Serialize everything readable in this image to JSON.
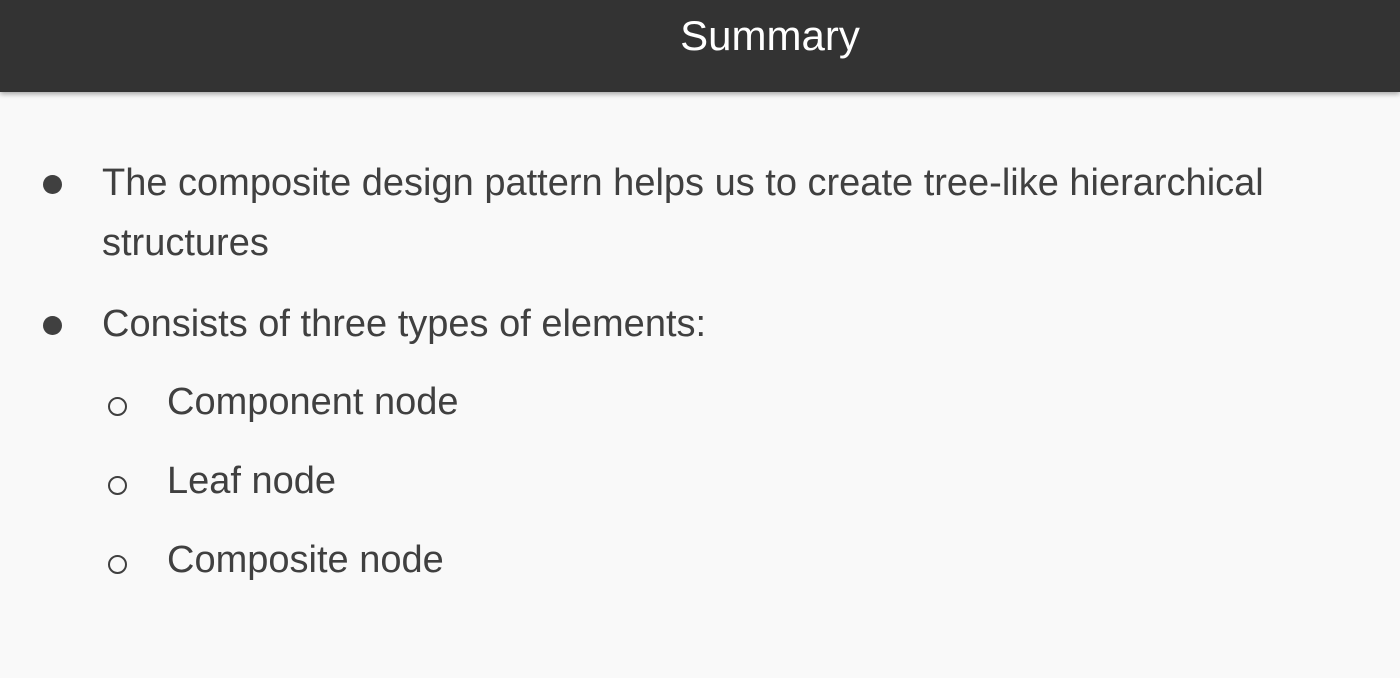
{
  "slide": {
    "title": "Summary",
    "bullets": [
      {
        "text": "The composite design pattern helps us to create tree-like hierarchical structures"
      },
      {
        "text": "Consists of three types of elements:",
        "sub_items": [
          {
            "text": "Component node"
          },
          {
            "text": "Leaf node"
          },
          {
            "text": "Composite node"
          }
        ]
      }
    ]
  },
  "colors": {
    "title_bar": "#333333",
    "background": "#f9f9f9",
    "text": "#404040"
  }
}
